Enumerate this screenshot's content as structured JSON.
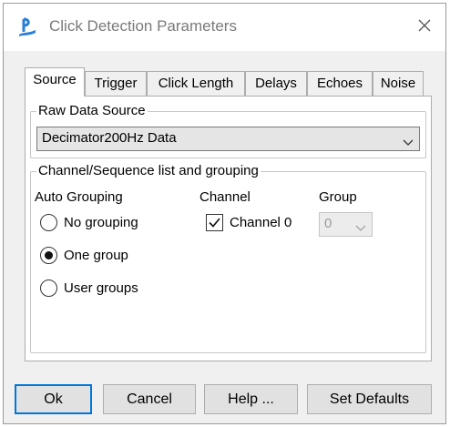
{
  "window": {
    "title": "Click Detection Parameters"
  },
  "tabs": [
    {
      "label": "Source"
    },
    {
      "label": "Trigger"
    },
    {
      "label": "Click Length"
    },
    {
      "label": "Delays"
    },
    {
      "label": "Echoes"
    },
    {
      "label": "Noise"
    }
  ],
  "raw_data_source": {
    "label": "Raw Data Source",
    "selected": "Decimator200Hz Data"
  },
  "channel_group": {
    "label": "Channel/Sequence list and grouping",
    "auto_grouping_label": "Auto Grouping",
    "channel_label": "Channel",
    "group_label": "Group",
    "radio_options": [
      {
        "label": "No grouping",
        "checked": false
      },
      {
        "label": "One group",
        "checked": true
      },
      {
        "label": "User groups",
        "checked": false
      }
    ],
    "channels": [
      {
        "label": "Channel 0",
        "checked": true,
        "group_value": "0"
      }
    ]
  },
  "buttons": {
    "ok": "Ok",
    "cancel": "Cancel",
    "help": "Help ...",
    "set_defaults": "Set Defaults"
  },
  "colors": {
    "accent": "#0078d7",
    "app_icon": "#2a7fd4"
  }
}
